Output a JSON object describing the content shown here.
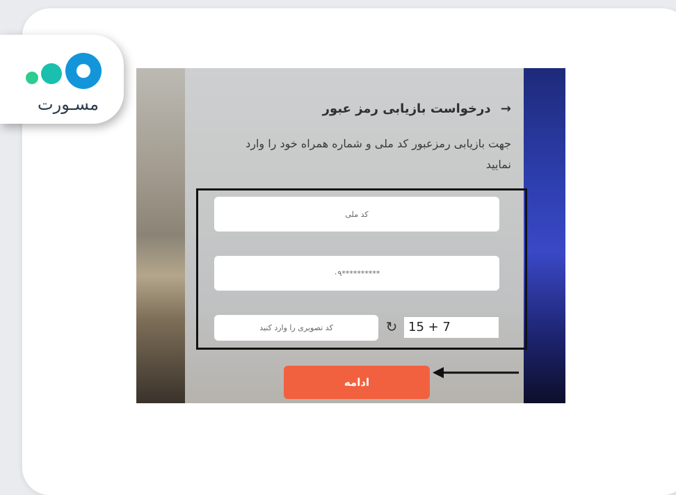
{
  "logo": {
    "text": "مسـورت",
    "icon": "three-dots-logo"
  },
  "form": {
    "title": "درخواست بازیابی رمز عبور",
    "back_arrow": "→",
    "description": "جهت بازیابی رمزعبور کد ملی و شماره همراه خود را وارد نمایید",
    "national_code_placeholder": "کد ملی",
    "phone_placeholder": "۰۹**********",
    "captcha_placeholder": "کد تصویری را وارد کنید",
    "captcha_text": "15 + 7",
    "refresh_icon": "↻",
    "submit_label": "ادامه"
  },
  "colors": {
    "accent": "#f2613f",
    "highlight_border": "#111111"
  }
}
